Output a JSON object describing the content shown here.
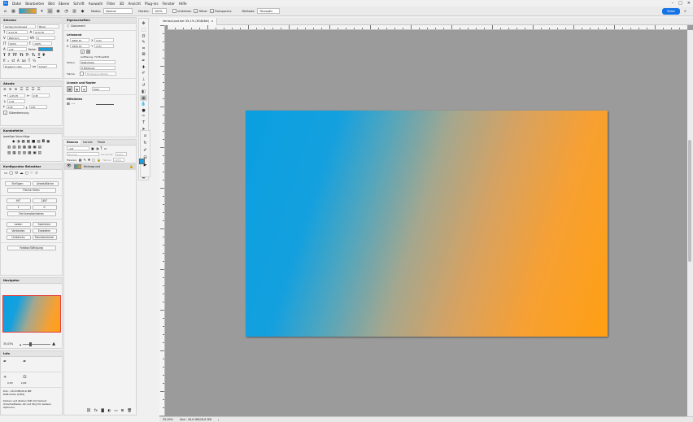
{
  "menu": [
    "Datei",
    "Bearbeiten",
    "Bild",
    "Ebene",
    "Schrift",
    "Auswahl",
    "Filter",
    "3D",
    "Ansicht",
    "Plug-ins",
    "Fenster",
    "Hilfe"
  ],
  "options_bar": {
    "mode_label": "Modus:",
    "mode_value": "Normal",
    "opacity_label": "Deckkr.:",
    "opacity_value": "100%",
    "reverse_label": "Umkehren",
    "dither_label": "Dither",
    "transparency_label": "Transparenz",
    "method_label": "Methode:",
    "method_value": "Perzeptiv",
    "share_label": "Teilen"
  },
  "character_panel": {
    "title": "Zeichen",
    "font_family": "Verdig Condensed",
    "font_style": "Black",
    "font_size": "6,22 Pt",
    "leading": "6,22 Pt",
    "tracking": "Metrisch",
    "kerning": "0",
    "vscale": "100%",
    "hscale": "100%",
    "baseline": "0 Pt",
    "color_label": "Farbe:",
    "color_hex": "#1aa0dc",
    "language": "Englisch: USA",
    "antialias": "Scharf"
  },
  "paragraph_panel": {
    "title": "Absatz",
    "indent_left": "1,05 Pt",
    "indent_right": "0 Pt",
    "indent_first": "0 Pt",
    "space_before": "0 Pt",
    "space_after": "0 Pt",
    "hyphenation_label": "Silbentrennung"
  },
  "shortcuts_panel": {
    "title": "Kurzbefehle",
    "subtitle": "Jeweilige Vorschläge"
  },
  "transform_panel": {
    "title": "Konfigurator Belastbar",
    "btn_fit": "Einfügen",
    "btn_clip": "Arbeitsfläche",
    "btn_fill": "Fläche füllen",
    "deg1": "90°",
    "deg2": "180°",
    "v1": "1",
    "v2": "0",
    "btn_free": "Frei transformieren",
    "btn_load": "Laden",
    "btn_save": "Speichern",
    "btn_combine": "Verbinden",
    "btn_expand": "Erweitern",
    "btn_invert": "Umkehren",
    "btn_transform": "Transformieren",
    "btn_history": "Farbton/Sättigung"
  },
  "navigator_panel": {
    "title": "Navigator",
    "zoom": "35,03%"
  },
  "info_panel": {
    "title": "Info",
    "x_val": "0,83",
    "y_val": "2,68",
    "doc_info": "Dok.: 26,6 MB/26,6 MB",
    "color_info": "RGB-Farbe (8-Bit)",
    "hint": "Klicken und Ziehen füllt mit Verlauf. Umschalttaste, Alt und Strg für weitere Optionen."
  },
  "properties_panel": {
    "title": "Eigenschaften",
    "kind": "Dokument",
    "canvas_title": "Leinwand",
    "width": "4800 Px",
    "height": "2600 Px",
    "x": "0 Px",
    "y": "0 Px",
    "resolution": "Auflösung: 72 Pixel/Zoll",
    "mode_label": "Modus",
    "mode": "RGB-Farbe",
    "depth": "8 Bit/Kanal",
    "fill_label": "Fläche",
    "fill": "Hintergrundfarbe",
    "rulers_title": "Lineale und Raster",
    "unit": "Pixel",
    "guides_title": "Hilfslinien"
  },
  "layers_panel": {
    "tabs": [
      "Ebenen",
      "Kanäle",
      "Pfade"
    ],
    "filter_label": "Art",
    "blend": "Normal",
    "opacity_label": "Deckkraft:",
    "opacity": "100%",
    "lock_label": "Fixieren:",
    "fill_label": "Fläche:",
    "fill": "100%",
    "layer_name": "Hintergrund"
  },
  "document": {
    "tab_title": "Verlauf.psd bei 35,1% (RGB/8#)",
    "zoom": "35,09%",
    "doc_size": "Dok.: 26,6 MB/26,6 MB"
  },
  "colors": {
    "foreground": "#1a9fdf",
    "background": "#ff9f12",
    "accent": "#1473e6"
  }
}
